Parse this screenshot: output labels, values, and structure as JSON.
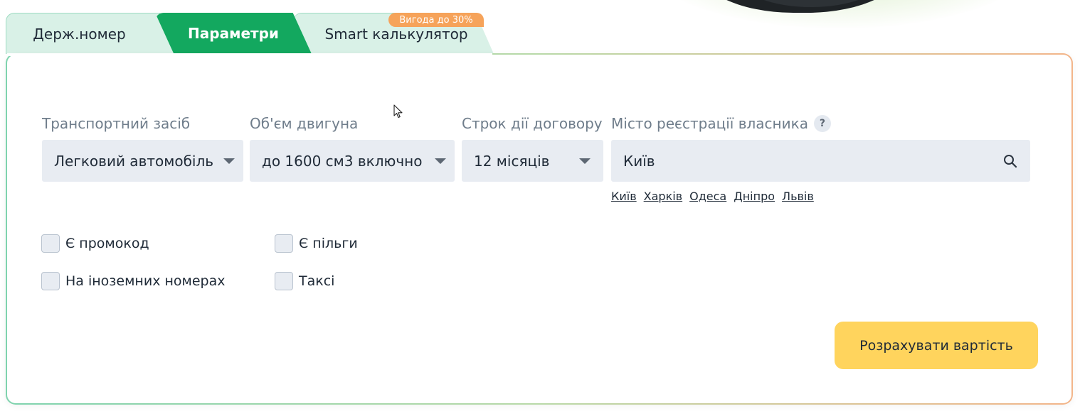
{
  "tabs": [
    {
      "label": "Держ.номер",
      "active": false
    },
    {
      "label": "Параметри",
      "active": true
    },
    {
      "label": "Smart калькулятор",
      "active": false
    }
  ],
  "promo_badge": "Вигода до 30%",
  "fields": {
    "vehicle": {
      "label": "Транспортний засіб",
      "value": "Легковий автомобіль"
    },
    "engine": {
      "label": "Об'єм двигуна",
      "value": "до 1600 см3 включно"
    },
    "term": {
      "label": "Строк дії договору",
      "value": "12 місяців"
    },
    "city": {
      "label": "Місто реєстрації власника",
      "value": "Київ",
      "help": "?"
    }
  },
  "city_shortcuts": [
    "Київ",
    "Харків",
    "Одеса",
    "Дніпро",
    "Львів"
  ],
  "checkboxes": [
    {
      "label": "Є промокод",
      "checked": false
    },
    {
      "label": "Є пільги",
      "checked": false
    },
    {
      "label": "На іноземних номерах",
      "checked": false
    },
    {
      "label": "Таксі",
      "checked": false
    }
  ],
  "submit_label": "Розрахувати вартість",
  "colors": {
    "accent_green": "#13a85f",
    "tab_inactive": "#d9f1e7",
    "badge_orange": "#f6a35a",
    "button_yellow": "#ffd45d",
    "input_bg": "#e8ecf2"
  }
}
